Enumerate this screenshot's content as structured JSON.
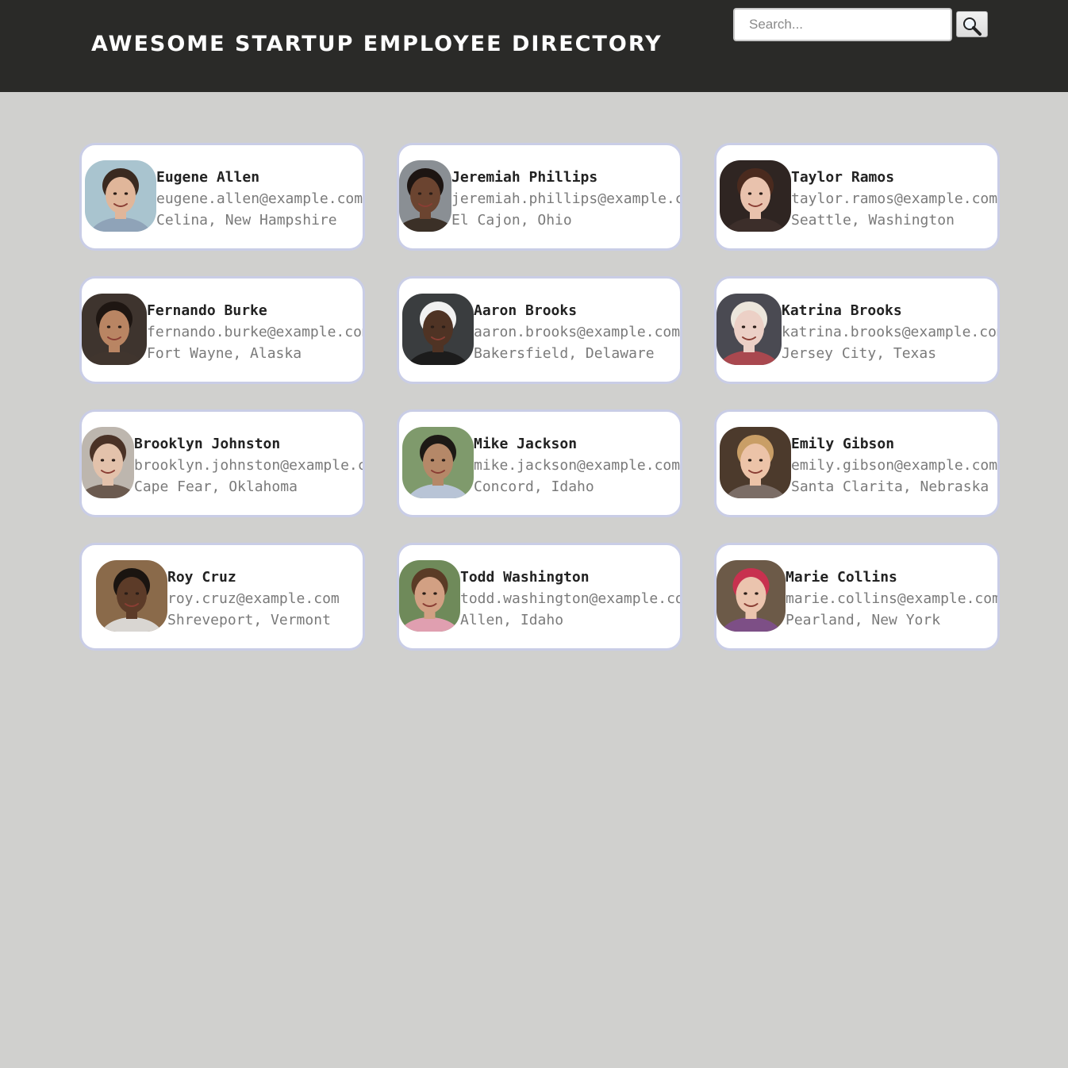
{
  "header": {
    "title": "Awesome Startup Employee Directory",
    "search_placeholder": "Search...",
    "search_icon": "magnifier-icon"
  },
  "employees": [
    {
      "name": "Eugene Allen",
      "email": "eugene.allen@example.com",
      "location": "Celina, New Hampshire",
      "skin": "#e0b69a",
      "hair": "#3a2a20",
      "bg": "#a9c4cf",
      "shirt": "#8fa3b8"
    },
    {
      "name": "Jeremiah Phillips",
      "email": "jeremiah.phillips@example.com",
      "location": "El Cajon, Ohio",
      "skin": "#6b4430",
      "hair": "#1d1512",
      "bg": "#8a8f94",
      "shirt": "#3b3027"
    },
    {
      "name": "Taylor Ramos",
      "email": "taylor.ramos@example.com",
      "location": "Seattle, Washington",
      "skin": "#e9c2ad",
      "hair": "#4a2a1e",
      "bg": "#2f2522",
      "shirt": "#3c2e2a"
    },
    {
      "name": "Fernando Burke",
      "email": "fernando.burke@example.com",
      "location": "Fort Wayne, Alaska",
      "skin": "#b98563",
      "hair": "#1e1612",
      "bg": "#3e342e",
      "shirt": "#40352e"
    },
    {
      "name": "Aaron Brooks",
      "email": "aaron.brooks@example.com",
      "location": "Bakersfield, Delaware",
      "skin": "#4f3324",
      "hair": "#f1f1f1",
      "bg": "#3a3d3f",
      "shirt": "#1c1c1c"
    },
    {
      "name": "Katrina Brooks",
      "email": "katrina.brooks@example.com",
      "location": "Jersey City, Texas",
      "skin": "#ecd0c6",
      "hair": "#ece6dc",
      "bg": "#4a4a52",
      "shirt": "#a9484f"
    },
    {
      "name": "Brooklyn Johnston",
      "email": "brooklyn.johnston@example.com",
      "location": "Cape Fear, Oklahoma",
      "skin": "#e3c2ab",
      "hair": "#4a3226",
      "bg": "#bdb6ae",
      "shirt": "#6b5a4f"
    },
    {
      "name": "Mike Jackson",
      "email": "mike.jackson@example.com",
      "location": "Concord, Idaho",
      "skin": "#b58868",
      "hair": "#1d1915",
      "bg": "#7f9a6c",
      "shirt": "#b8c4d6"
    },
    {
      "name": "Emily Gibson",
      "email": "emily.gibson@example.com",
      "location": "Santa Clarita, Nebraska",
      "skin": "#ecc3a8",
      "hair": "#c99e66",
      "bg": "#4c3a2c",
      "shirt": "#7b6d66"
    },
    {
      "name": "Roy Cruz",
      "email": "roy.cruz@example.com",
      "location": "Shreveport, Vermont",
      "skin": "#5c3b28",
      "hair": "#1a1410",
      "bg": "#8a6a4a",
      "shirt": "#d9d6d2"
    },
    {
      "name": "Todd Washington",
      "email": "todd.washington@example.com",
      "location": "Allen, Idaho",
      "skin": "#d2a083",
      "hair": "#5a3b26",
      "bg": "#6f8a5a",
      "shirt": "#e09fb0"
    },
    {
      "name": "Marie Collins",
      "email": "marie.collins@example.com",
      "location": "Pearland, New York",
      "skin": "#ebc4ae",
      "hair": "#c8314f",
      "bg": "#6c5a48",
      "shirt": "#7d4f86"
    }
  ]
}
